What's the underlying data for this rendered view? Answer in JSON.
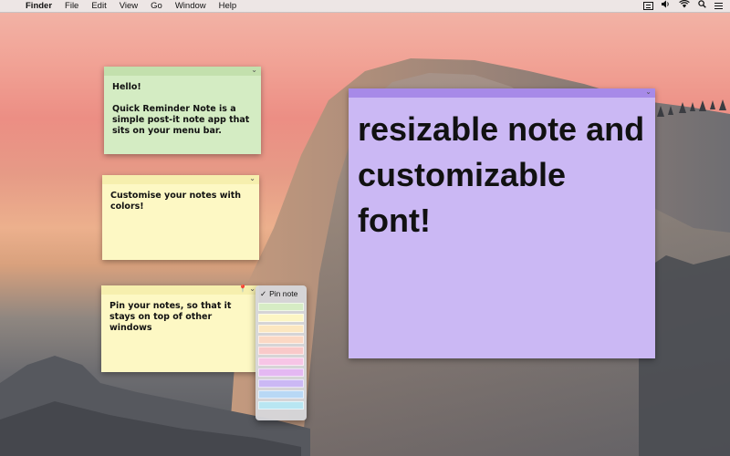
{
  "menubar": {
    "apple_glyph": "",
    "items": [
      {
        "label": "Finder",
        "bold": true
      },
      {
        "label": "File"
      },
      {
        "label": "Edit"
      },
      {
        "label": "View"
      },
      {
        "label": "Go"
      },
      {
        "label": "Window"
      },
      {
        "label": "Help"
      }
    ],
    "status_icons": [
      "note-status-icon",
      "volume-icon",
      "wifi-icon",
      "spotlight-icon",
      "notification-list-icon"
    ]
  },
  "notes": {
    "green": {
      "text": "Hello!\n\nQuick Reminder Note is a simple post-it note app that sits on your menu bar.",
      "color": "#d4ecc3"
    },
    "yellow1": {
      "text": "Customise your notes with colors!",
      "color": "#fdf8c4"
    },
    "yellow2": {
      "text": "Pin your notes, so that it stays on top of other windows",
      "color": "#fdf8c4"
    },
    "purple": {
      "text": "resizable note and customizable font!",
      "color": "#cbb8f4"
    }
  },
  "dropdown": {
    "pin_label": "Pin note",
    "check_glyph": "✓",
    "swatches": [
      "#d6ecc4",
      "#fdf6c4",
      "#fce7c0",
      "#fbd8c4",
      "#f9c9c9",
      "#f7c5e6",
      "#e4b8f2",
      "#cbb8f4",
      "#b8d8f5",
      "#b8e6f2"
    ]
  }
}
